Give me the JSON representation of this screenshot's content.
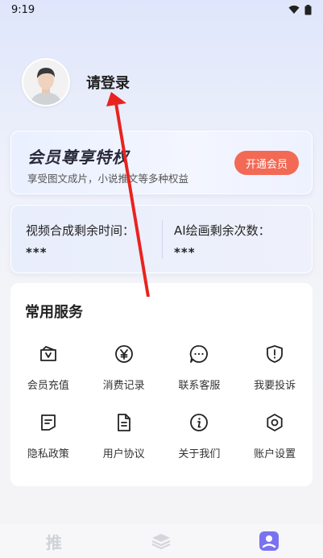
{
  "status_bar": {
    "time": "9:19"
  },
  "profile": {
    "login_label": "请登录"
  },
  "vip": {
    "title": "会员尊享特权",
    "description": "享受图文成片，小说推文等多种权益",
    "button_label": "开通会员",
    "button_color": "#f26a55"
  },
  "quota": {
    "video": {
      "label": "视频合成剩余时间：",
      "value": "***"
    },
    "ai_draw": {
      "label": "AI绘画剩余次数：",
      "value": "***"
    }
  },
  "services": {
    "title": "常用服务",
    "items": [
      {
        "label": "会员充值",
        "icon": "vip-recharge-icon"
      },
      {
        "label": "消费记录",
        "icon": "yen-icon"
      },
      {
        "label": "联系客服",
        "icon": "chat-icon"
      },
      {
        "label": "我要投诉",
        "icon": "shield-alert-icon"
      },
      {
        "label": "隐私政策",
        "icon": "privacy-document-icon"
      },
      {
        "label": "用户协议",
        "icon": "agreement-document-icon"
      },
      {
        "label": "关于我们",
        "icon": "info-icon"
      },
      {
        "label": "账户设置",
        "icon": "hexagon-settings-icon"
      }
    ]
  },
  "bottom_nav": {
    "items": [
      {
        "label": "推",
        "icon": "recommend-icon",
        "active": false
      },
      {
        "icon": "layers-icon",
        "active": false
      },
      {
        "icon": "profile-icon",
        "active": true
      }
    ],
    "active_color": "#7a73f0"
  }
}
